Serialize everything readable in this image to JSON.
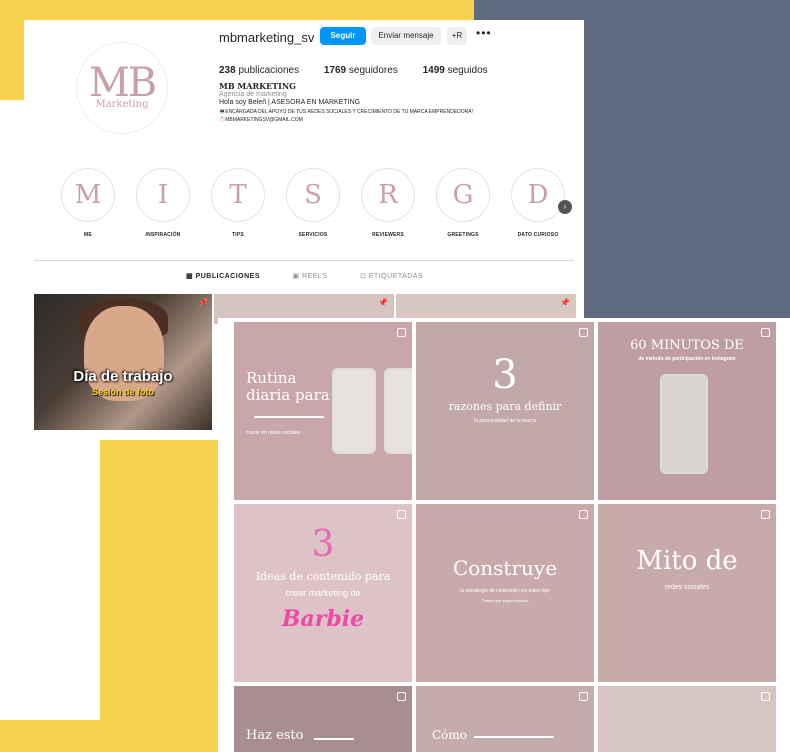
{
  "profile": {
    "username": "mbmarketing_sv",
    "follow_label": "Seguir",
    "message_label": "Enviar mensaje",
    "add_label": "+R",
    "more_label": "•••",
    "avatar_initials": "MB",
    "avatar_sub": "Marketing",
    "posts_count": "238",
    "posts_label": "publicaciones",
    "followers_count": "1769",
    "followers_label": "seguidores",
    "following_count": "1499",
    "following_label": "seguidos",
    "name": "MB MARKETING",
    "category": "Agencia de marketing",
    "bio_line1": "Hola soy Beleñ | ASESORA EN MARKETING",
    "bio_line2": "💻ENCARGADA DEL APOYO DE TUS REDES SOCIALES Y CRECIMIENTO DE TU MARCA EMPRENDEDORA!",
    "bio_line3": "📩MBMARKETINGSV@GMAIL.COM"
  },
  "highlights": [
    {
      "letter": "M",
      "label": "ME"
    },
    {
      "letter": "I",
      "label": "INSPIRACIÓN"
    },
    {
      "letter": "T",
      "label": "TIPS"
    },
    {
      "letter": "S",
      "label": "SERVICIOS"
    },
    {
      "letter": "R",
      "label": "REVIEWERS"
    },
    {
      "letter": "G",
      "label": "GREETINGS"
    },
    {
      "letter": "D",
      "label": "DATO CURIOSO"
    }
  ],
  "tabs": [
    {
      "icon": "grid-icon",
      "label": "PUBLICACIONES"
    },
    {
      "icon": "reels-icon",
      "label": "REELS"
    },
    {
      "icon": "tagged-icon",
      "label": "ETIQUETADAS"
    }
  ],
  "posts": {
    "post1_title": "Día de trabajo",
    "post1_sub": "Sesión de foto"
  },
  "grid": {
    "c1_title": "Rutina diaria para",
    "c1_sub": "crecer en redes sociales",
    "c2_num": "3",
    "c2_title": "razones para definir",
    "c2_sub": "la personalidad de tu marca",
    "c3_title": "60 MINUTOS DE",
    "c3_sub": "de método de participación en Instagram",
    "c4_num": "3",
    "c4_title": "Ideas de contenido para",
    "c4_sub": "crear marketing de",
    "c4_brand": "Barbie",
    "c5_title": "Construye",
    "c5_sub": "tu estrategia de contenido con estos tips",
    "c5_sub2": "Tienes que seguir leyendo",
    "c6_title": "Mito de",
    "c6_sub": "redes sociales",
    "c7_title": "Haz esto",
    "c8_title": "Cómo"
  },
  "colors": {
    "accent": "#0095f6",
    "navy": "#5f6a80",
    "yellow": "#f7d24e",
    "pink": "#c9a6aa"
  }
}
